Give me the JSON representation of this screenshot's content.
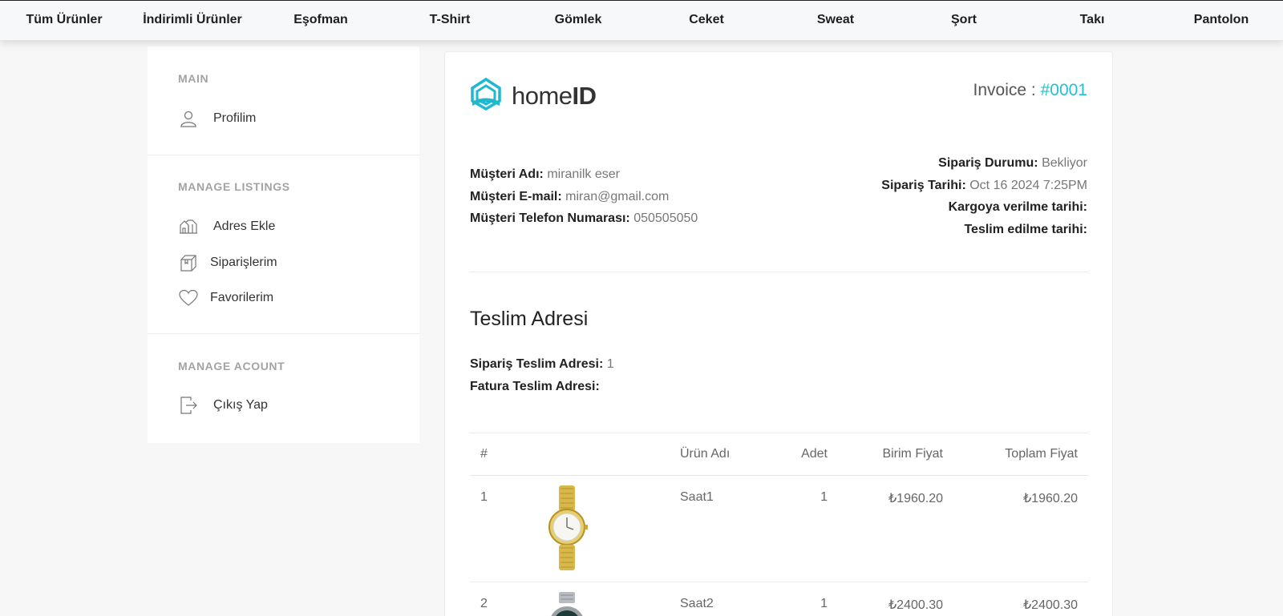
{
  "nav": {
    "items": [
      "Tüm Ürünler",
      "İndirimli Ürünler",
      "Eşofman",
      "T-Shirt",
      "Gömlek",
      "Ceket",
      "Sweat",
      "Şort",
      "Takı",
      "Pantolon"
    ]
  },
  "sidebar": {
    "sections": [
      {
        "title": "MAIN",
        "items": [
          {
            "label": "Profilim",
            "icon": "user-icon"
          }
        ]
      },
      {
        "title": "MANAGE LISTINGS",
        "items": [
          {
            "label": "Adres Ekle",
            "icon": "buildings-icon"
          },
          {
            "label": "Siparişlerim",
            "icon": "box-icon"
          },
          {
            "label": "Favorilerim",
            "icon": "heart-icon"
          }
        ]
      },
      {
        "title": "MANAGE ACOUNT",
        "items": [
          {
            "label": "Çıkış Yap",
            "icon": "logout-icon"
          }
        ]
      }
    ]
  },
  "invoice": {
    "logo_text_light": "home",
    "logo_text_bold": "ID",
    "label": "Invoice : ",
    "number": "#0001",
    "customer": {
      "name_label": "Müşteri Adı:",
      "name": "miranilk eser",
      "email_label": "Müşteri E-mail:",
      "email": "miran@gmail.com",
      "phone_label": "Müşteri Telefon Numarası:",
      "phone": "050505050"
    },
    "order": {
      "status_label": "Sipariş Durumu:",
      "status": "Bekliyor",
      "date_label": "Sipariş Tarihi:",
      "date": "Oct 16 2024 7:25PM",
      "shipped_label": "Kargoya verilme tarihi:",
      "shipped": "",
      "delivered_label": "Teslim edilme tarihi:",
      "delivered": ""
    },
    "address": {
      "title": "Teslim Adresi",
      "order_label": "Sipariş Teslim Adresi:",
      "order_value": "1",
      "billing_label": "Fatura Teslim Adresi:",
      "billing_value": ""
    },
    "table": {
      "headers": [
        "#",
        "Ürün Adı",
        "Adet",
        "Birim Fiyat",
        "Toplam Fiyat"
      ],
      "rows": [
        {
          "no": "1",
          "name": "Saat1",
          "qty": "1",
          "unit": "₺1960.20",
          "total": "₺1960.20",
          "image": "gold-watch"
        },
        {
          "no": "2",
          "name": "Saat2",
          "qty": "1",
          "unit": "₺2400.30",
          "total": "₺2400.30",
          "image": "silver-watch"
        }
      ]
    }
  },
  "colors": {
    "accent": "#20c1d4",
    "logo": "#1fb9cf"
  }
}
